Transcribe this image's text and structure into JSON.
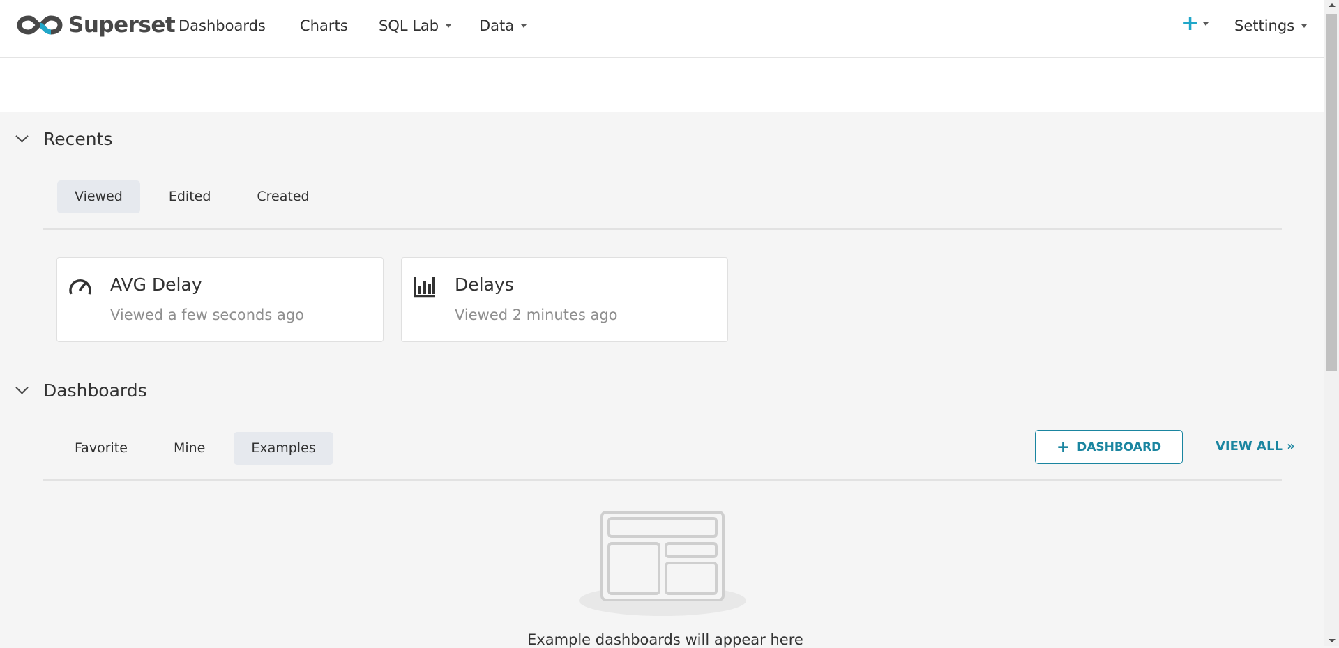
{
  "navbar": {
    "brand": "Superset",
    "items": [
      "Dashboards",
      "Charts",
      "SQL Lab",
      "Data"
    ],
    "settings": "Settings"
  },
  "recents": {
    "title": "Recents",
    "tabs": [
      "Viewed",
      "Edited",
      "Created"
    ],
    "active_tab": "Viewed",
    "cards": [
      {
        "title": "AVG Delay",
        "subtitle": "Viewed a few seconds ago",
        "icon": "gauge-icon"
      },
      {
        "title": "Delays",
        "subtitle": "Viewed 2 minutes ago",
        "icon": "bar-chart-icon"
      }
    ]
  },
  "dashboards": {
    "title": "Dashboards",
    "tabs": [
      "Favorite",
      "Mine",
      "Examples"
    ],
    "active_tab": "Examples",
    "add_button": "DASHBOARD",
    "view_all": "VIEW ALL »",
    "empty_text": "Example dashboards will appear here"
  },
  "colors": {
    "accent": "#1a85a0",
    "plus": "#20a7c9",
    "background": "#f5f5f5"
  }
}
